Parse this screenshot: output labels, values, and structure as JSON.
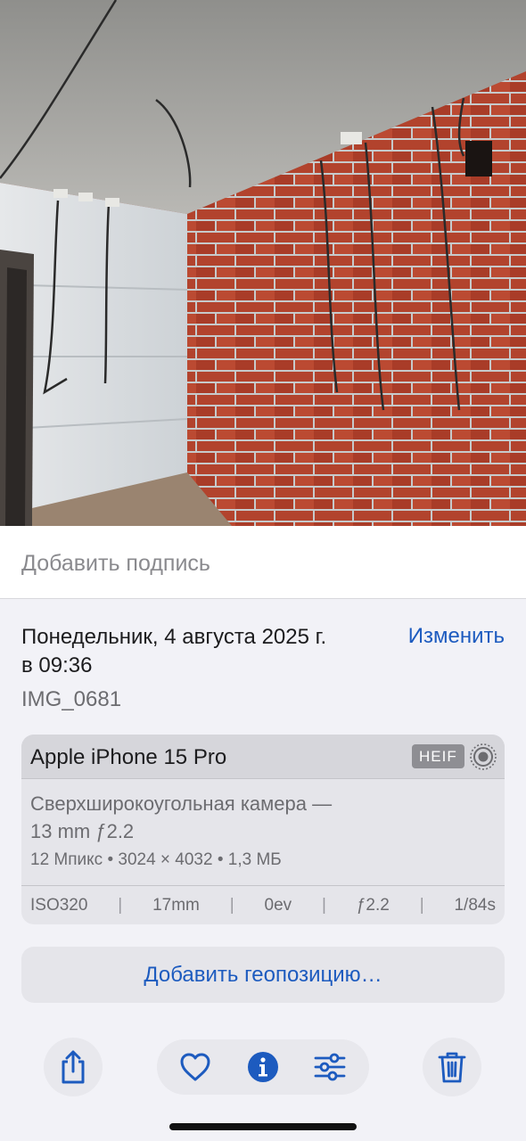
{
  "caption": {
    "placeholder": "Добавить подпись"
  },
  "meta": {
    "date_line1": "Понедельник, 4 августа 2025 г.",
    "date_line2": "в 09:36",
    "edit_label": "Изменить",
    "filename": "IMG_0681"
  },
  "device": {
    "name": "Apple iPhone 15 Pro",
    "format_badge": "HEIF",
    "lens_line1": "Сверхширокоугольная камера —",
    "lens_line2": "13 mm ƒ2.2",
    "specs": "12 Мпикс • 3024 × 4032 • 1,3 МБ",
    "exif": {
      "iso": "ISO320",
      "focal": "17mm",
      "ev": "0ev",
      "aperture": "ƒ2.2",
      "shutter": "1/84s",
      "separator": "|"
    }
  },
  "location": {
    "label": "Добавить геопозицию…"
  },
  "toolbar": {
    "share_icon": "share-icon",
    "favorite_icon": "heart-icon",
    "info_icon": "info-icon",
    "adjust_icon": "sliders-icon",
    "delete_icon": "trash-icon"
  },
  "colors": {
    "accent": "#1d5bbf",
    "background": "#f2f2f7",
    "card": "#e5e5ea"
  }
}
